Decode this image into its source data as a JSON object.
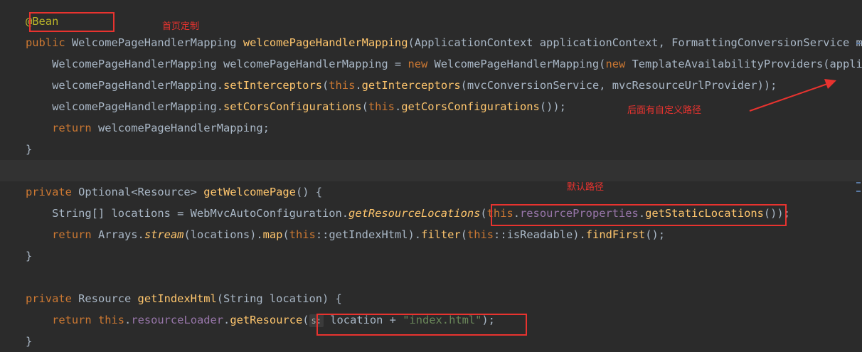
{
  "editor": {
    "lines": [
      {
        "id": "l1",
        "segments": [
          {
            "t": "@Bean",
            "c": "anno"
          }
        ]
      },
      {
        "id": "l2",
        "segments": [
          {
            "t": "public ",
            "c": "kw"
          },
          {
            "t": "WelcomePageHandlerMapping",
            "c": "ty"
          },
          {
            "t": " "
          },
          {
            "t": "welcomePageHandlerMapping",
            "c": "fn"
          },
          {
            "t": "(ApplicationContext applicationContext, FormattingConversionService mv"
          }
        ]
      },
      {
        "id": "l3",
        "segments": [
          {
            "t": "    WelcomePageHandlerMapping welcomePageHandlerMapping = "
          },
          {
            "t": "new ",
            "c": "kw"
          },
          {
            "t": "WelcomePageHandlerMapping("
          },
          {
            "t": "new ",
            "c": "kw"
          },
          {
            "t": "TemplateAvailabilityProviders(applic"
          }
        ]
      },
      {
        "id": "l4",
        "segments": [
          {
            "t": "    welcomePageHandlerMapping."
          },
          {
            "t": "setInterceptors",
            "c": "fn"
          },
          {
            "t": "("
          },
          {
            "t": "this",
            "c": "kw"
          },
          {
            "t": "."
          },
          {
            "t": "getInterceptors",
            "c": "fn"
          },
          {
            "t": "(mvcConversionService, mvcResourceUrlProvider));"
          }
        ]
      },
      {
        "id": "l5",
        "segments": [
          {
            "t": "    welcomePageHandlerMapping."
          },
          {
            "t": "setCorsConfigurations",
            "c": "fn"
          },
          {
            "t": "("
          },
          {
            "t": "this",
            "c": "kw"
          },
          {
            "t": "."
          },
          {
            "t": "getCorsConfigurations",
            "c": "fn"
          },
          {
            "t": "());"
          }
        ]
      },
      {
        "id": "l6",
        "segments": [
          {
            "t": "    "
          },
          {
            "t": "return ",
            "c": "kw"
          },
          {
            "t": "welcomePageHandlerMapping;"
          }
        ]
      },
      {
        "id": "l7",
        "segments": [
          {
            "t": "}"
          }
        ]
      },
      {
        "id": "l8",
        "segments": [
          {
            "t": ""
          }
        ]
      },
      {
        "id": "l9",
        "segments": [
          {
            "t": "private ",
            "c": "kw"
          },
          {
            "t": "Optional<Resource> "
          },
          {
            "t": "getWelcomePage",
            "c": "fn"
          },
          {
            "t": "() {"
          }
        ]
      },
      {
        "id": "l10",
        "segments": [
          {
            "t": "    String[] locations = WebMvcAutoConfiguration."
          },
          {
            "t": "getResourceLocations",
            "c": "fn ital"
          },
          {
            "t": "("
          },
          {
            "t": "this",
            "c": "kw"
          },
          {
            "t": "."
          },
          {
            "t": "resourceProperties",
            "c": "fld"
          },
          {
            "t": "."
          },
          {
            "t": "getStaticLocations",
            "c": "fn"
          },
          {
            "t": "());"
          }
        ]
      },
      {
        "id": "l11",
        "segments": [
          {
            "t": "    "
          },
          {
            "t": "return ",
            "c": "kw"
          },
          {
            "t": "Arrays."
          },
          {
            "t": "stream",
            "c": "fn ital"
          },
          {
            "t": "(locations)."
          },
          {
            "t": "map",
            "c": "fn"
          },
          {
            "t": "("
          },
          {
            "t": "this",
            "c": "kw"
          },
          {
            "t": "::getIndexHtml)."
          },
          {
            "t": "filter",
            "c": "fn"
          },
          {
            "t": "("
          },
          {
            "t": "this",
            "c": "kw"
          },
          {
            "t": "::isReadable)."
          },
          {
            "t": "findFirst",
            "c": "fn"
          },
          {
            "t": "();"
          }
        ]
      },
      {
        "id": "l12",
        "segments": [
          {
            "t": "}"
          }
        ]
      },
      {
        "id": "l13",
        "segments": [
          {
            "t": ""
          }
        ]
      },
      {
        "id": "l14",
        "segments": [
          {
            "t": "private ",
            "c": "kw"
          },
          {
            "t": "Resource "
          },
          {
            "t": "getIndexHtml",
            "c": "fn"
          },
          {
            "t": "(String location) {"
          }
        ]
      },
      {
        "id": "l15",
        "segments": [
          {
            "t": "    "
          },
          {
            "t": "return ",
            "c": "kw"
          },
          {
            "t": "this",
            "c": "kw"
          },
          {
            "t": "."
          },
          {
            "t": "resourceLoader",
            "c": "fld"
          },
          {
            "t": "."
          },
          {
            "t": "getResource",
            "c": "fn"
          },
          {
            "t": "("
          },
          {
            "t": "s:",
            "c": "hint"
          },
          {
            "t": " location + "
          },
          {
            "t": "\"index.html\"",
            "c": "str"
          },
          {
            "t": ");"
          }
        ]
      },
      {
        "id": "l16",
        "segments": [
          {
            "t": "}"
          }
        ]
      }
    ]
  },
  "annotations": {
    "homepage_custom": "首页定制",
    "custom_path_after": "后面有自定义路径",
    "default_path": "默认路径"
  },
  "colors": {
    "background": "#2b2b2b",
    "keyword": "#cc7832",
    "method": "#ffc66d",
    "field": "#9876aa",
    "string": "#6a8759",
    "annotation": "#bbb529",
    "markup_red": "#e8332f"
  }
}
